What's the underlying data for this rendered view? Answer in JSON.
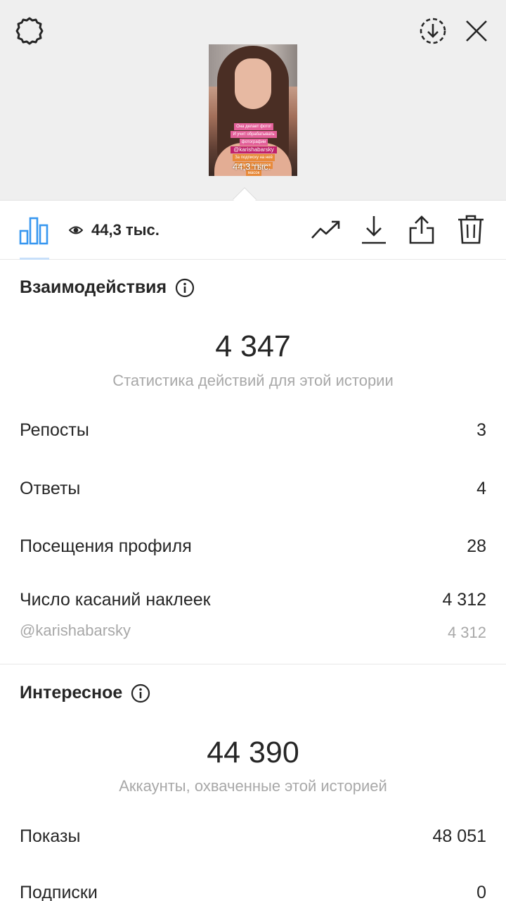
{
  "story": {
    "sticker_lines": [
      "Она делает фото!",
      "И учит обрабатывать",
      "фотографии"
    ],
    "sticker_mention": "@karishabarsky",
    "sticker_cta": [
      "За подписку на неё",
      "получи в подарок",
      "масок"
    ],
    "thumbnail_views": "44,3 тыс."
  },
  "toolbar": {
    "views_count": "44,3 тыс.",
    "tab_color": "#3897f0"
  },
  "interactions": {
    "title": "Взаимодействия",
    "total": "4 347",
    "caption": "Статистика действий для этой истории",
    "rows": [
      {
        "label": "Репосты",
        "value": "3"
      },
      {
        "label": "Ответы",
        "value": "4"
      },
      {
        "label": "Посещения профиля",
        "value": "28"
      },
      {
        "label": "Число касаний наклеек",
        "value": "4 312"
      }
    ],
    "sticker_sub": {
      "label": "@karishabarsky",
      "value": "4 312"
    }
  },
  "discovery": {
    "title": "Интересное",
    "total": "44 390",
    "caption": "Аккаунты, охваченные этой историей",
    "rows": [
      {
        "label": "Показы",
        "value": "48 051"
      },
      {
        "label": "Подписки",
        "value": "0"
      }
    ]
  }
}
